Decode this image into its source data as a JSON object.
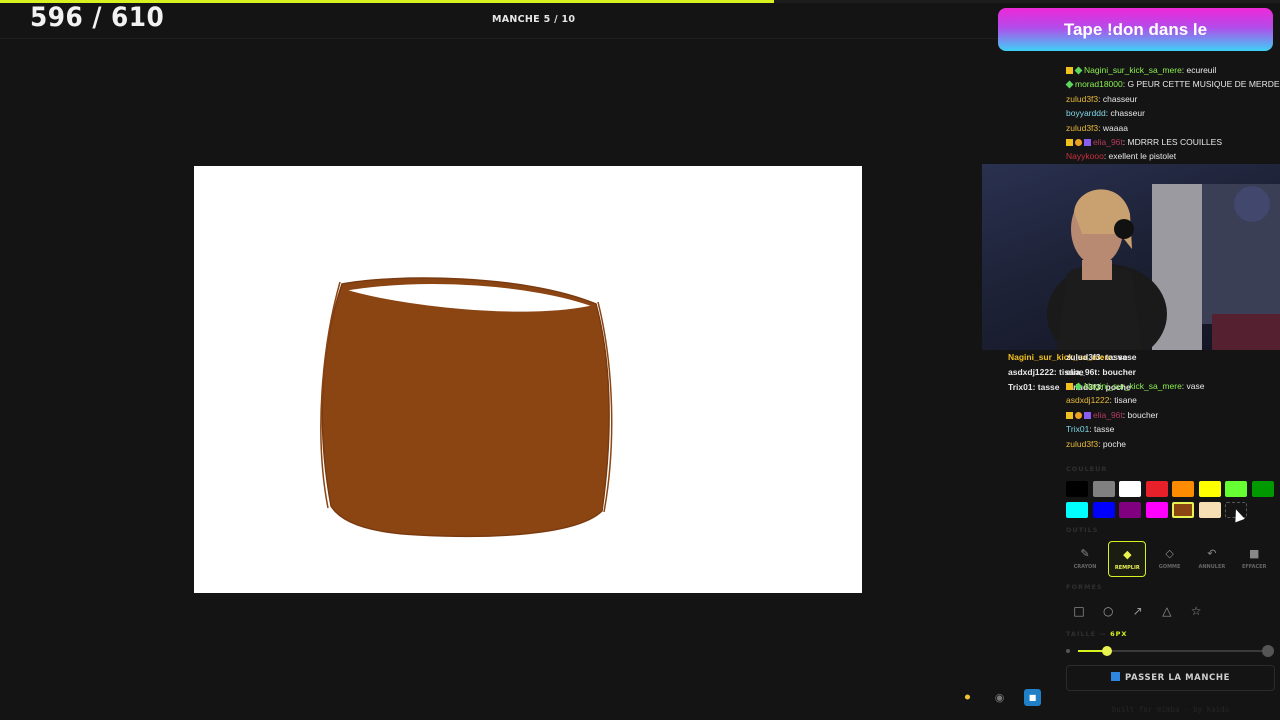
{
  "header": {
    "score": "596 / 610",
    "round": "MANCHE 5 / 10",
    "progress": 0.605
  },
  "banner": {
    "text": "Tape !don dans le"
  },
  "chat": [
    {
      "user": "Nagini_sur_kick_sa_mere",
      "message": "ecureuil",
      "color": "#8cf050",
      "badges": [
        "crown",
        "diamond"
      ]
    },
    {
      "user": "morad18000",
      "message": "G PEUR CETTE MUSIQUE DE MERDE",
      "color": "#8cf050",
      "badges": [
        "diamond"
      ]
    },
    {
      "user": "zulud3f3",
      "message": "chasseur",
      "color": "#e8b93a",
      "badges": []
    },
    {
      "user": "boyyarddd",
      "message": "chasseur",
      "color": "#7fd8e8",
      "badges": []
    },
    {
      "user": "zulud3f3",
      "message": "waaaa",
      "color": "#e8b93a",
      "badges": []
    },
    {
      "user": "elia_96t",
      "message": "MDRRR LES COUILLES",
      "color": "#b53a5e",
      "badges": [
        "crown",
        "bits",
        "cube"
      ]
    },
    {
      "user": "Nayykooo",
      "message": "exellent le pistolet",
      "color": "#c83040",
      "badges": []
    }
  ],
  "chat_lower": [
    {
      "user": "Nagini_sur_kick_sa_mere",
      "message": "vase",
      "color": "#8cf050",
      "badges": [
        "crown",
        "diamond"
      ]
    },
    {
      "user": "asdxdj1222",
      "message": "tisane",
      "color": "#e8b93a",
      "badges": []
    },
    {
      "user": "elia_96t",
      "message": "boucher",
      "color": "#b53a5e",
      "badges": [
        "crown",
        "bits",
        "cube"
      ]
    },
    {
      "user": "Trix01",
      "message": "tasse",
      "color": "#7fd8e8",
      "badges": []
    },
    {
      "user": "zulud3f3",
      "message": "poche",
      "color": "#e8b93a",
      "badges": []
    }
  ],
  "overlay_chat": [
    {
      "user": "Nagini_sur_kick_sa_mere",
      "message": "vase"
    },
    {
      "user": "zulud3f3",
      "message": "tasse"
    },
    {
      "user": "asdxdj1222",
      "message": "tisane"
    },
    {
      "user": "elia_96t",
      "message": "boucher"
    },
    {
      "user": "Trix01",
      "message": "tasse"
    },
    {
      "user": "zulud3f3",
      "message": "poche"
    }
  ],
  "palette": {
    "label": "COULEUR",
    "selected": "#8b4513",
    "colors": [
      "#000000",
      "#808080",
      "#ffffff",
      "#e8202a",
      "#ff8c00",
      "#ffff00",
      "#66ff33",
      "#009900",
      "#00ffff",
      "#0000ff",
      "#800080",
      "#ff00ff",
      "#8b4513",
      "#f5deb3"
    ]
  },
  "tools": {
    "label": "OUTILS",
    "items": [
      {
        "name": "pencil",
        "label": "CRAYON",
        "icon": "pencil-icon",
        "active": false
      },
      {
        "name": "fill",
        "label": "REMPLIR",
        "icon": "fill-bucket-icon",
        "active": true
      },
      {
        "name": "eraser",
        "label": "GOMME",
        "icon": "eraser-icon",
        "active": false
      },
      {
        "name": "undo",
        "label": "ANNULER",
        "icon": "undo-icon",
        "active": false
      },
      {
        "name": "clear",
        "label": "EFFACER",
        "icon": "trash-icon",
        "active": false
      }
    ]
  },
  "shapes": {
    "label": "FORMES",
    "items": [
      "rectangle",
      "ellipse",
      "arrow",
      "triangle",
      "star"
    ]
  },
  "size": {
    "label": "TAILLE",
    "value": "6PX",
    "level": 0.16
  },
  "pass_button": "PASSER LA MANCHE",
  "footer": "built for mimba - by kaido",
  "accent": "#d8f21f",
  "paint_color": "#8b4513"
}
